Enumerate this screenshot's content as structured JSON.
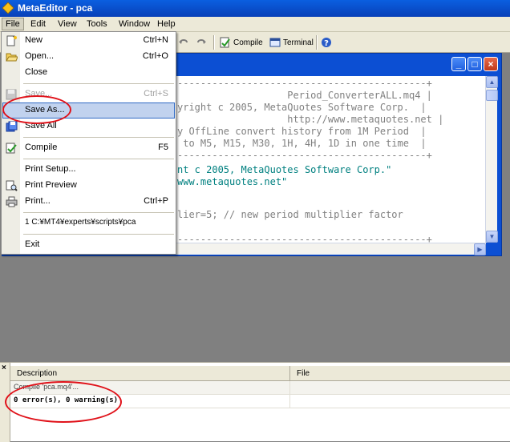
{
  "window": {
    "title": "MetaEditor - pca"
  },
  "menu": {
    "items": [
      "File",
      "Edit",
      "View",
      "Tools",
      "Window",
      "Help"
    ],
    "active": "File"
  },
  "toolbar": {
    "compile_label": "Compile",
    "terminal_label": "Terminal"
  },
  "file_menu": {
    "items": [
      {
        "label": "New",
        "shortcut": "Ctrl+N",
        "icon": "new-file-icon"
      },
      {
        "label": "Open...",
        "shortcut": "Ctrl+O",
        "icon": "open-folder-icon"
      },
      {
        "label": "Close",
        "shortcut": ""
      },
      {
        "label": "Save...",
        "shortcut": "Ctrl+S",
        "icon": "save-icon",
        "disabled": true
      },
      {
        "label": "Save As...",
        "shortcut": "",
        "highlighted": true
      },
      {
        "label": "Save All",
        "shortcut": "",
        "icon": "save-all-icon"
      },
      {
        "label": "Compile",
        "shortcut": "F5",
        "icon": "compile-icon"
      },
      {
        "label": "Print Setup...",
        "shortcut": ""
      },
      {
        "label": "Print Preview",
        "shortcut": "",
        "icon": "print-preview-icon"
      },
      {
        "label": "Print...",
        "shortcut": "Ctrl+P",
        "icon": "printer-icon"
      },
      {
        "label": "1 C:¥MT4¥experts¥scripts¥pca",
        "shortcut": ""
      },
      {
        "label": "Exit",
        "shortcut": ""
      }
    ]
  },
  "code_lines": [
    "-------------------------------------------+",
    "                   Period_ConverterALL.mq4 |",
    "yright c 2005, MetaQuotes Software Corp.  |",
    "                   http://www.metaquotes.net |",
    "y OffLine convert history from 1M Period  |",
    " to M5, M15, M30, 1H, 4H, 1D in one time  |",
    "-------------------------------------------+",
    "nt c 2005, MetaQuotes Software Corp.\"",
    "www.metaquotes.net\"",
    "lier=5; // new period multiplier factor",
    "-------------------------------------------+"
  ],
  "output": {
    "headers": {
      "description": "Description",
      "file": "File"
    },
    "rows": [
      "Compile 'pca.mq4'...",
      "0 error(s), 0 warning(s)"
    ]
  },
  "colors": {
    "titlebar": "#0a5fe0",
    "highlight": "#c1d2ee",
    "annotation": "#e0121a"
  }
}
